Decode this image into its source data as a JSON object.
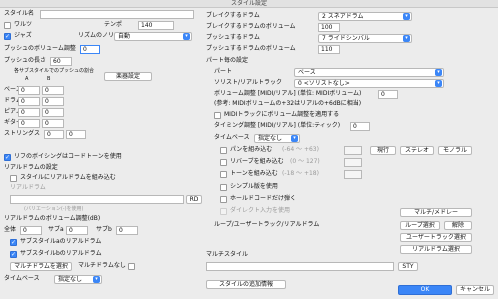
{
  "window_title": "スタイル設定",
  "left": {
    "style_name_label": "スタイル名",
    "waltz": "ワルツ",
    "tempo_label": "テンポ",
    "tempo_value": "140",
    "jazz": "ジャズ",
    "rhythm_feel_label": "リズムのノリ",
    "rhythm_feel_value": "自動",
    "push_volume_label": "プッシュのボリューム調整",
    "push_volume_value": "0",
    "push_length_label": "プッシュの長さ",
    "push_length_value": "60",
    "push_ratio_label": "各サブスタイルでのプッシュの割合",
    "col_a": "A",
    "col_b": "B",
    "instrument_settings_button": "楽器設定",
    "instruments": [
      {
        "name": "ベース",
        "a": "0",
        "b": "0"
      },
      {
        "name": "ドラム",
        "a": "0",
        "b": "0"
      },
      {
        "name": "ピアノ",
        "a": "0",
        "b": "0"
      },
      {
        "name": "ギター",
        "a": "0",
        "b": "0"
      },
      {
        "name": "ストリングス",
        "a": "0",
        "b": "0"
      }
    ],
    "revoicing": "リフのボイシングはコードトーンを使用",
    "real_drums_settings": "リアルドラムの設定",
    "include_real_drums": "スタイルにリアルドラムを組み込む",
    "real_drums_label": "リアルドラム",
    "variation_placeholder": "(バリエーション(-)を使用)",
    "rd_button": "RD",
    "rd_volume_label": "リアルドラムのボリューム調整(dB)",
    "all_label": "全体",
    "all_value": "0",
    "sub_a_label": "サブa",
    "sub_a_value": "0",
    "sub_b_label": "サブb",
    "sub_b_value": "0",
    "substyle_a": "サブスタイルaのリアルドラム",
    "substyle_b": "サブスタイルbのリアルドラム",
    "multi_drum_select": "マルチドラムを選択",
    "multi_drum_none": "マルチドラムなし",
    "timebase_label": "タイムベース",
    "timebase_value": "指定なし"
  },
  "right": {
    "break_drum_label": "ブレイクするドラム",
    "break_drum_value": "2 スネアドラム",
    "break_drum_volume_label": "ブレイクするドラムのボリューム",
    "break_drum_volume_value": "100",
    "push_drum_label": "プッシュするドラム",
    "push_drum_value": "7 ライドシンバル",
    "push_drum_volume_label": "プッシュするドラムのボリューム",
    "push_drum_volume_value": "110",
    "per_part_label": "パート毎の設定",
    "part_label": "パート",
    "part_value": "ベース",
    "soloist_label": "ソリスト/リアルトラック",
    "soloist_value": "0 <ソリストなし>",
    "volume_adjust_label": "ボリューム調整 [MIDI/リアル] (単位: MIDIボリューム)",
    "volume_adjust_value": "0",
    "volume_note": "(参考: MIDIボリュームの+32はリアルの+6dBに相当)",
    "apply_midi_volume": "MIDIトラックにボリューム調整を適用する",
    "timing_adjust_label": "タイミング調整 [MIDI/リアル] (単位:ティック)",
    "timing_adjust_value": "0",
    "timebase_label": "タイムベース",
    "timebase_value": "指定なし",
    "pan_label": "パンを組み込む",
    "pan_range": "(-64 ～ +63)",
    "reverb_label": "リバーブを組み込む",
    "reverb_range": "(0 ～ 127)",
    "tone_label": "トーンを組み込む",
    "tone_range": "(-18 ～ +18)",
    "mono_button": "現行",
    "stereo_button": "ステレオ",
    "monaural_button": "モノラル",
    "simple_label": "シンプル版を使用",
    "hold_label": "ホールドコードだけ弾く",
    "direct_input_label": "ダイレクト入力を使用",
    "multi_medley_button": "マルチ/メドレー",
    "loop_label": "ループ/ユーザートラック/リアルドラム",
    "loop_select_button": "ループ選択",
    "remove_button": "解除",
    "user_track_button": "ユーザートラック選択",
    "real_drum_select_button": "リアルドラム選択",
    "multi_style_label": "マルチスタイル",
    "sty_button": "STY",
    "add_style_info_button": "スタイルの追加情報",
    "ok_button": "OK",
    "cancel_button": "キャンセル"
  }
}
